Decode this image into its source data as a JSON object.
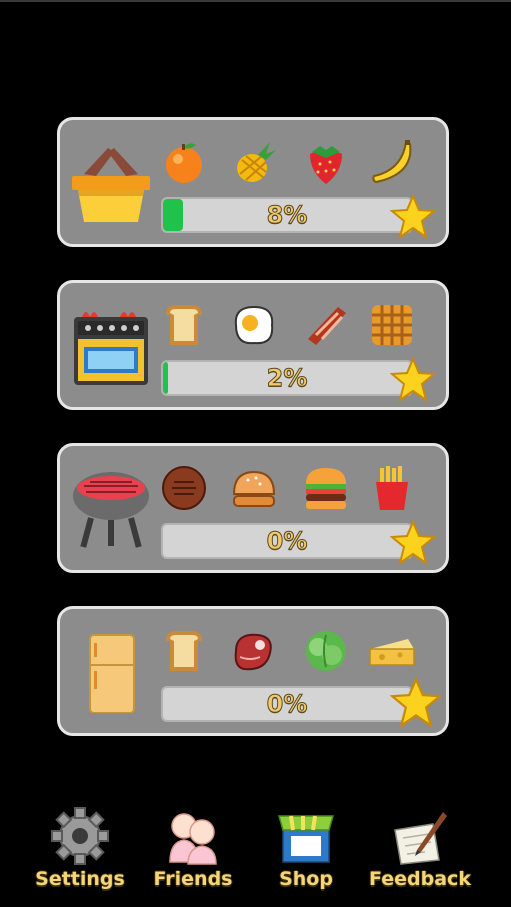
{
  "colors": {
    "progress_fill": "#21c24a",
    "panel": "#8c8c8c",
    "label_gold": "#f5d577"
  },
  "cards": [
    {
      "category_icon": "basket-icon",
      "items": [
        "orange-icon",
        "pineapple-icon",
        "strawberry-icon",
        "banana-icon"
      ],
      "progress": 8,
      "progress_label": "8%"
    },
    {
      "category_icon": "stove-icon",
      "items": [
        "toast-icon",
        "fried-egg-icon",
        "bacon-icon",
        "waffle-icon"
      ],
      "progress": 2,
      "progress_label": "2%"
    },
    {
      "category_icon": "grill-icon",
      "items": [
        "patty-icon",
        "bun-icon",
        "burger-icon",
        "fries-icon"
      ],
      "progress": 0,
      "progress_label": "0%"
    },
    {
      "category_icon": "fridge-icon",
      "items": [
        "bread-icon",
        "steak-icon",
        "lettuce-icon",
        "cheese-icon"
      ],
      "progress": 0,
      "progress_label": "0%"
    }
  ],
  "nav": {
    "settings": "Settings",
    "friends": "Friends",
    "shop": "Shop",
    "feedback": "Feedback"
  }
}
